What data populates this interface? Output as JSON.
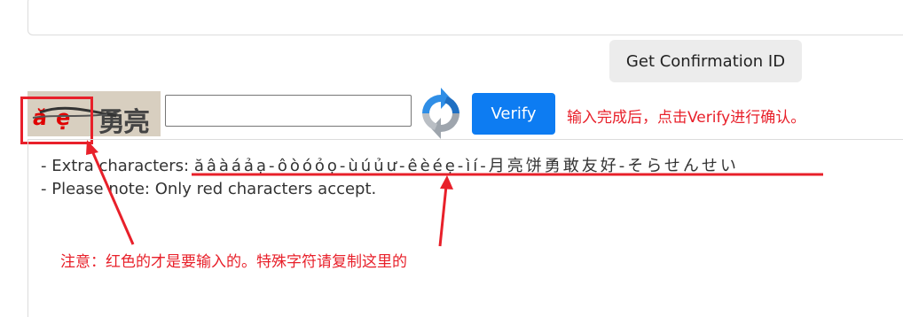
{
  "top_panel": {},
  "confirmation": {
    "get_button_label": "Get Confirmation ID"
  },
  "captcha": {
    "red_chars": "ăẹ",
    "dark_chars": "勇亮"
  },
  "input": {
    "value": "",
    "placeholder": ""
  },
  "verify": {
    "label": "Verify"
  },
  "hint_after_verify": "输入完成后，点击Verify进行确认。",
  "info": {
    "extra_prefix": "- Extra characters: ",
    "extra_chars": "ăâàáảạ-ôòóỏọ-ùúủư-êèéẹ-ìí-月亮饼勇敢友好-そらせんせい",
    "note_line": "- Please note: Only red characters accept."
  },
  "annotation_note": "注意：红色的才是要输入的。特殊字符请复制这里的",
  "colors": {
    "accent_red": "#e8202a",
    "verify_blue": "#0d7cf2",
    "button_gray": "#ececec"
  },
  "icons": {
    "refresh": "refresh-captcha-icon"
  }
}
